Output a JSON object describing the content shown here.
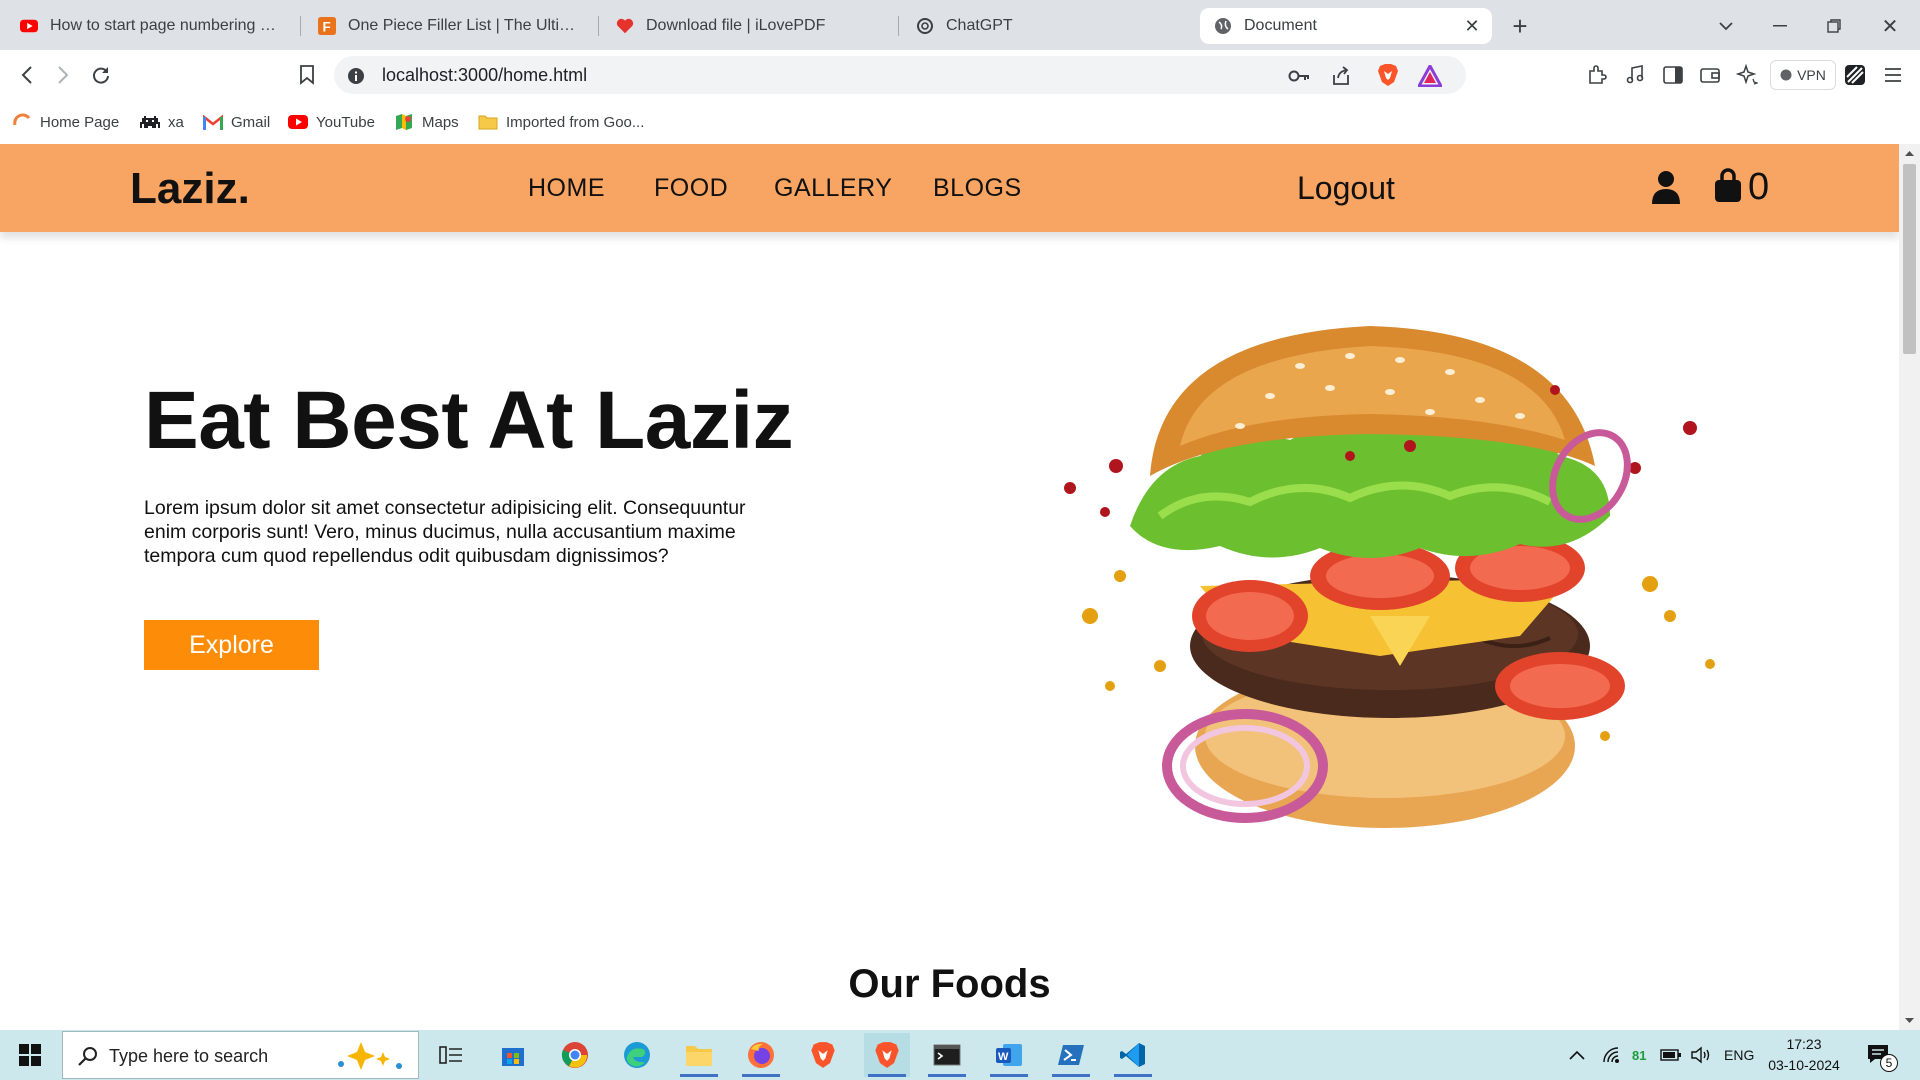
{
  "browser": {
    "tabs": [
      {
        "title": "How to start page numbering from",
        "icon": "youtube-icon"
      },
      {
        "title": "One Piece Filler List | The Ultimate A",
        "icon": "filler-list-icon"
      },
      {
        "title": "Download file | iLovePDF",
        "icon": "ilovepdf-icon"
      },
      {
        "title": "ChatGPT",
        "icon": "chatgpt-icon"
      },
      {
        "title": "Document",
        "icon": "globe-icon",
        "active": true
      }
    ],
    "url": "localhost:3000/home.html",
    "vpn_label": "VPN",
    "bookmarks": [
      {
        "label": "Home Page",
        "icon": "home-page-icon"
      },
      {
        "label": "xa",
        "icon": "invader-icon"
      },
      {
        "label": "Gmail",
        "icon": "gmail-icon"
      },
      {
        "label": "YouTube",
        "icon": "youtube-icon"
      },
      {
        "label": "Maps",
        "icon": "maps-icon"
      },
      {
        "label": "Imported from Goo...",
        "icon": "folder-icon"
      }
    ]
  },
  "site": {
    "logo": "Laziz.",
    "nav": [
      "HOME",
      "FOOD",
      "GALLERY",
      "BLOGS"
    ],
    "logout": "Logout",
    "cart_count": "0",
    "accent_color": "#f8a462",
    "button_color": "#fd8d09"
  },
  "hero": {
    "title": "Eat Best At Laziz",
    "text": "Lorem ipsum dolor sit amet consectetur adipisicing elit. Consequuntur enim corporis sunt! Vero, minus ducimus, nulla accusantium maxime tempora cum quod repellendus odit quibusdam dignissimos?",
    "button": "Explore"
  },
  "section": {
    "title": "Our Foods"
  },
  "taskbar": {
    "search_placeholder": "Type here to search",
    "battery": "81",
    "language": "ENG",
    "time": "17:23",
    "date": "03-10-2024",
    "notifications": "5"
  }
}
